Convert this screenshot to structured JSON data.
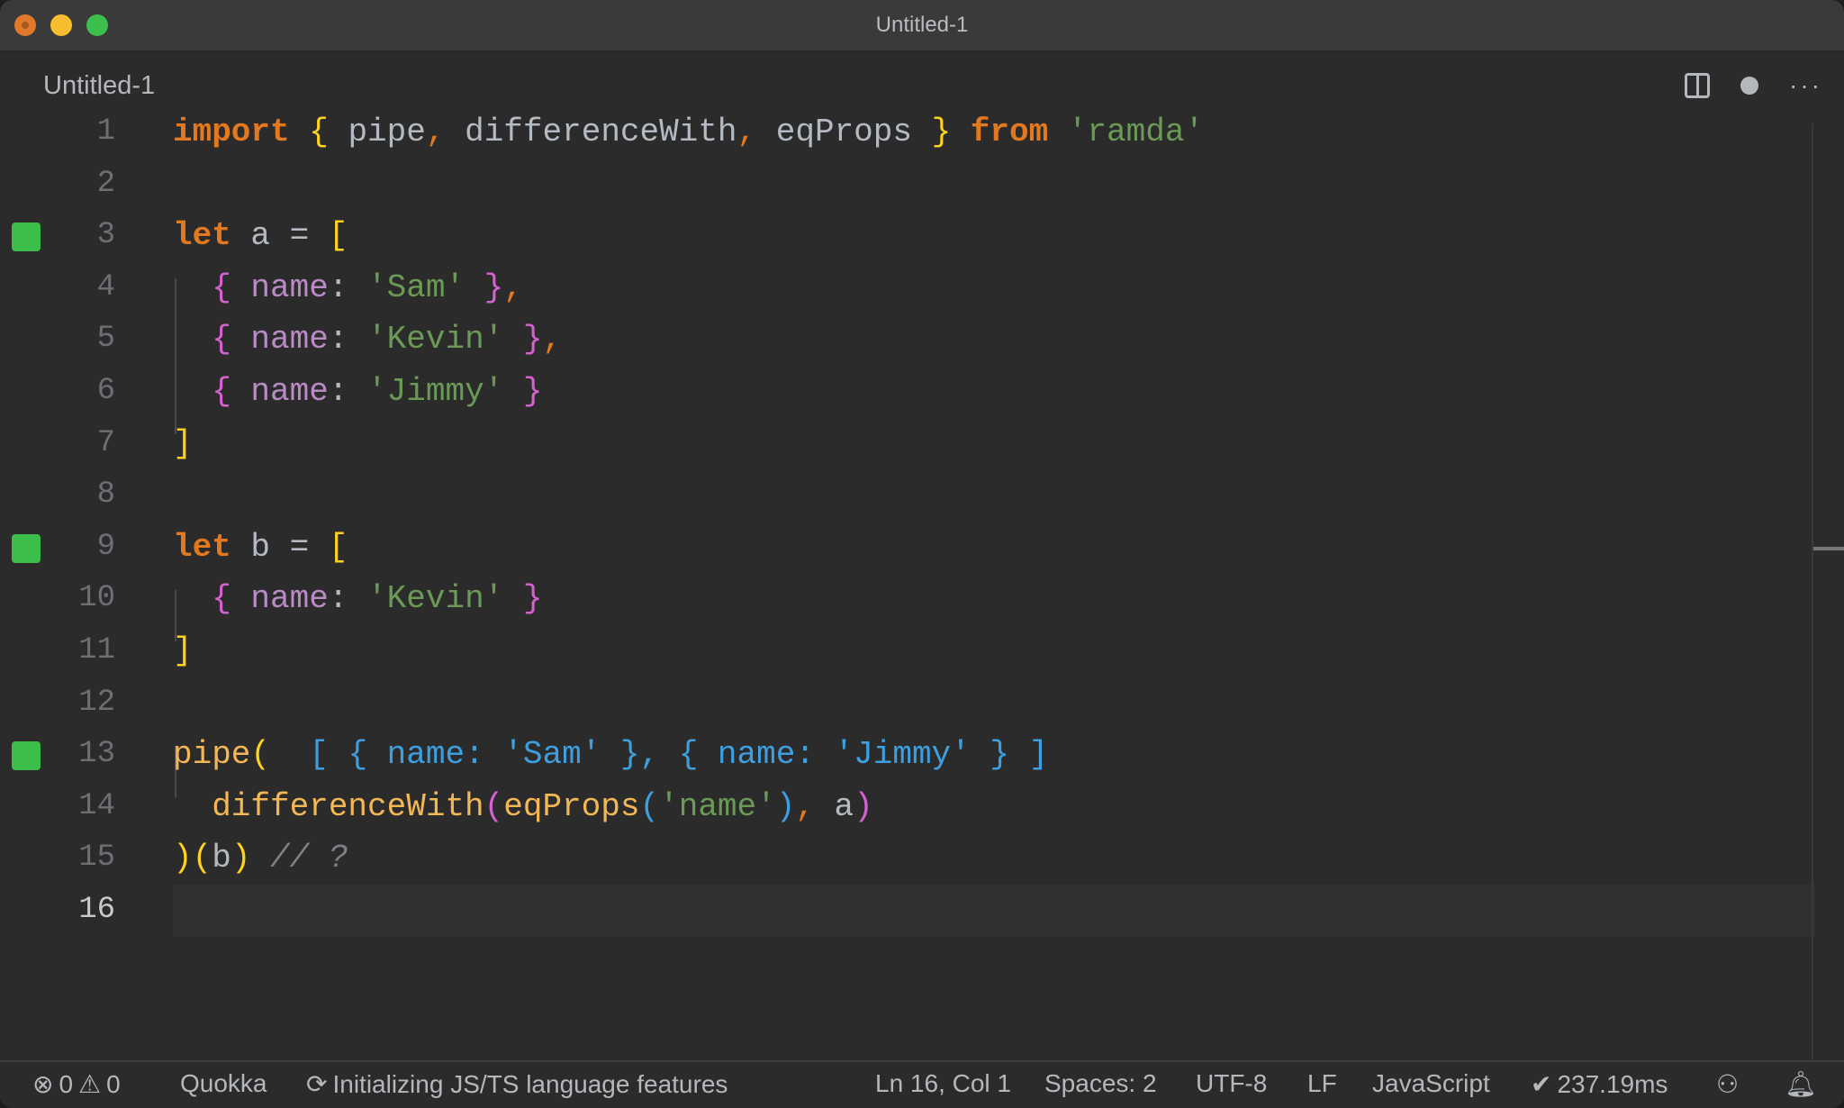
{
  "window": {
    "title": "Untitled-1"
  },
  "tab": {
    "label": "Untitled-1",
    "actions": [
      "split-editor",
      "unsaved-dot",
      "more-actions"
    ],
    "more_label": "···"
  },
  "editor": {
    "current_line": 16,
    "lines": [
      {
        "n": "1",
        "marker": false
      },
      {
        "n": "2",
        "marker": false
      },
      {
        "n": "3",
        "marker": true
      },
      {
        "n": "4",
        "marker": false
      },
      {
        "n": "5",
        "marker": false
      },
      {
        "n": "6",
        "marker": false
      },
      {
        "n": "7",
        "marker": false
      },
      {
        "n": "8",
        "marker": false
      },
      {
        "n": "9",
        "marker": true
      },
      {
        "n": "10",
        "marker": false
      },
      {
        "n": "11",
        "marker": false
      },
      {
        "n": "12",
        "marker": false
      },
      {
        "n": "13",
        "marker": true
      },
      {
        "n": "14",
        "marker": false
      },
      {
        "n": "15",
        "marker": false
      },
      {
        "n": "16",
        "marker": false
      }
    ],
    "tokens": [
      [
        [
          "kw",
          "import"
        ],
        [
          "",
          ""
        ],
        [
          "br-y",
          " {"
        ],
        [
          "",
          " pipe"
        ],
        [
          "punc",
          ","
        ],
        [
          "",
          " differenceWith"
        ],
        [
          "punc",
          ","
        ],
        [
          "",
          " eqProps "
        ],
        [
          "br-y",
          "}"
        ],
        [
          "kw",
          " from"
        ],
        [
          "str",
          " 'ramda'"
        ]
      ],
      [],
      [
        [
          "kw",
          "let"
        ],
        [
          "",
          " a = "
        ],
        [
          "br-y",
          "["
        ]
      ],
      [
        [
          "br-p",
          "  {"
        ],
        [
          "prop",
          " name"
        ],
        [
          "",
          ":"
        ],
        [
          "str",
          " 'Sam'"
        ],
        [
          "br-p",
          " }"
        ],
        [
          "punc",
          ","
        ]
      ],
      [
        [
          "br-p",
          "  {"
        ],
        [
          "prop",
          " name"
        ],
        [
          "",
          ":"
        ],
        [
          "str",
          " 'Kevin'"
        ],
        [
          "br-p",
          " }"
        ],
        [
          "punc",
          ","
        ]
      ],
      [
        [
          "br-p",
          "  {"
        ],
        [
          "prop",
          " name"
        ],
        [
          "",
          ":"
        ],
        [
          "str",
          " 'Jimmy'"
        ],
        [
          "br-p",
          " }"
        ]
      ],
      [
        [
          "br-y",
          "]"
        ]
      ],
      [],
      [
        [
          "kw",
          "let"
        ],
        [
          "",
          " b = "
        ],
        [
          "br-y",
          "["
        ]
      ],
      [
        [
          "br-p",
          "  {"
        ],
        [
          "prop",
          " name"
        ],
        [
          "",
          ":"
        ],
        [
          "str",
          " 'Kevin'"
        ],
        [
          "br-p",
          " }"
        ]
      ],
      [
        [
          "br-y",
          "]"
        ]
      ],
      [],
      [
        [
          "fn",
          "pipe"
        ],
        [
          "br-y",
          "("
        ],
        [
          "inline-hint",
          "  [ { name: 'Sam' }, { name: 'Jimmy' } ]"
        ]
      ],
      [
        [
          "fn",
          "  differenceWith"
        ],
        [
          "br-p",
          "("
        ],
        [
          "fn",
          "eqProps"
        ],
        [
          "br-b",
          "("
        ],
        [
          "str",
          "'name'"
        ],
        [
          "br-b",
          ")"
        ],
        [
          "punc",
          ","
        ],
        [
          "",
          " a"
        ],
        [
          "br-p",
          ")"
        ]
      ],
      [
        [
          "br-y",
          ")("
        ],
        [
          "",
          "b"
        ],
        [
          "br-y",
          ")"
        ],
        [
          "cmt",
          " // ?"
        ]
      ],
      []
    ]
  },
  "statusbar": {
    "errors": "0",
    "warnings": "0",
    "quokka": "Quokka",
    "initializing": "Initializing JS/TS language features",
    "cursor": "Ln 16, Col 1",
    "indent": "Spaces: 2",
    "encoding": "UTF-8",
    "eol": "LF",
    "language": "JavaScript",
    "timing": "237.19ms"
  },
  "colors": {
    "keyword": "#e2791f",
    "string": "#6a9a55",
    "property": "#b98ac4",
    "function": "#f3b755",
    "bracket_yellow": "#ffd21f",
    "bracket_pink": "#d861d2",
    "bracket_blue": "#3d9fe0",
    "gutter_marker": "#3bbf4a"
  }
}
